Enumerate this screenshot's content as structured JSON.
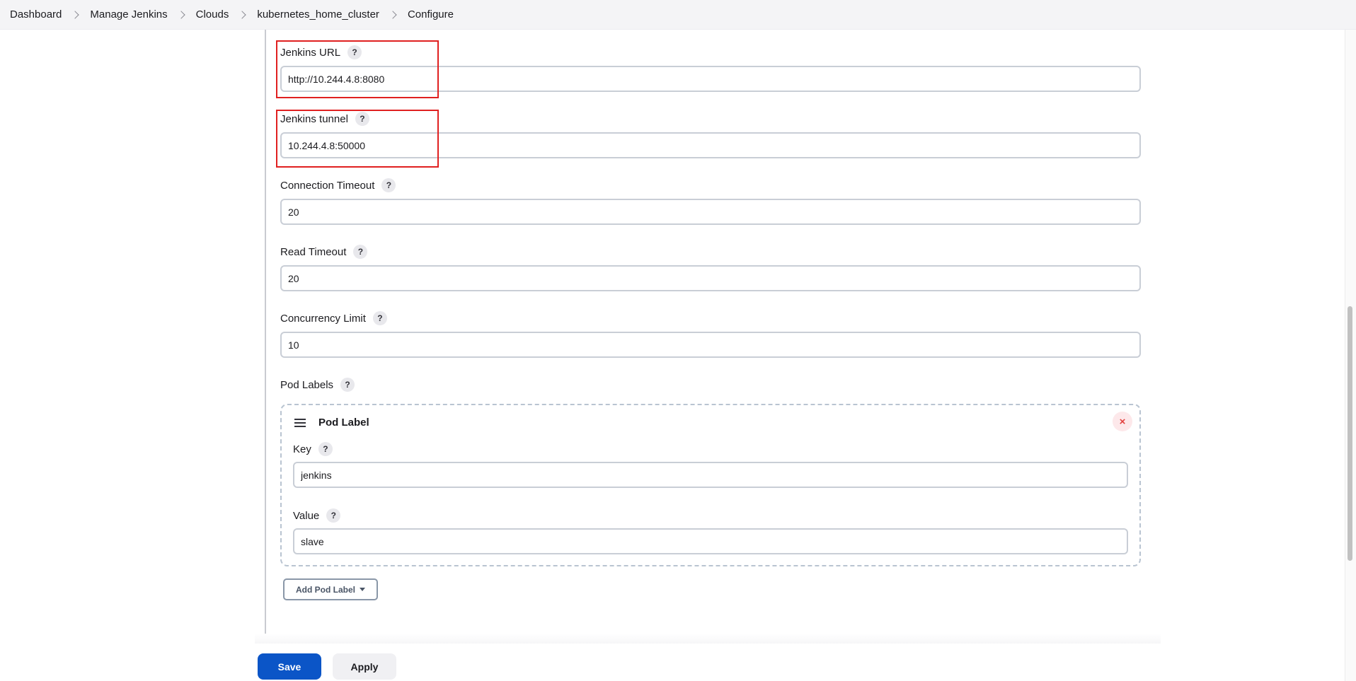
{
  "breadcrumb": {
    "items": [
      "Dashboard",
      "Manage Jenkins",
      "Clouds",
      "kubernetes_home_cluster",
      "Configure"
    ]
  },
  "help_glyph": "?",
  "fields": {
    "jenkins_url": {
      "label": "Jenkins URL",
      "value": "http://10.244.4.8:8080"
    },
    "jenkins_tunnel": {
      "label": "Jenkins tunnel",
      "value": "10.244.4.8:50000"
    },
    "connection_timeout": {
      "label": "Connection Timeout",
      "value": "20"
    },
    "read_timeout": {
      "label": "Read Timeout",
      "value": "20"
    },
    "concurrency_limit": {
      "label": "Concurrency Limit",
      "value": "10"
    }
  },
  "pod_labels": {
    "label": "Pod Labels",
    "card_title": "Pod Label",
    "key_label": "Key",
    "key_value": "jenkins",
    "value_label": "Value",
    "value_value": "slave",
    "delete_glyph": "×",
    "add_button": "Add Pod Label"
  },
  "actions": {
    "save": "Save",
    "apply": "Apply"
  },
  "colors": {
    "primary": "#0b55c7",
    "highlight": "#e02020",
    "danger": "#e2403e"
  }
}
